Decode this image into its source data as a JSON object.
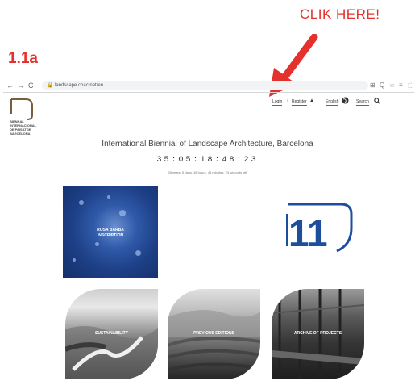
{
  "annotation": {
    "callout": "CLIK HERE!",
    "step": "1.1a"
  },
  "browser": {
    "back": "←",
    "forward": "→",
    "reload": "C",
    "url": "landscape.coac.net/en",
    "toolbar_icons": [
      "⊞",
      "Q",
      "☆",
      "≡",
      "⬚"
    ]
  },
  "site": {
    "logo_text": "BIENNAL INTERNACIONAL DE PAISATGE BARCELONA",
    "login": "Login",
    "separator": "/",
    "register": "Register",
    "register_icon": "user-icon",
    "language": "English",
    "language_icon": "globe-icon",
    "search": "Search",
    "search_icon": "search-icon",
    "title": "International Biennial of Landscape Architecture, Barcelona",
    "countdown": "35:05:18:48:23",
    "countdown_sub": "35 years, 5 days, 18 hours, 48 minutes, 23 seconds left",
    "tiles": {
      "inscription": "ROSA BARBA\nINSCRIPTION",
      "edition_number": "11",
      "sustainability": "SUSTAINABILITY",
      "previous": "PREVIOUS EDITIONS",
      "archive": "ARCHIVE OF PROJECTS"
    }
  },
  "colors": {
    "annotation_red": "#e5312d",
    "edition_blue": "#1d4e9c"
  }
}
